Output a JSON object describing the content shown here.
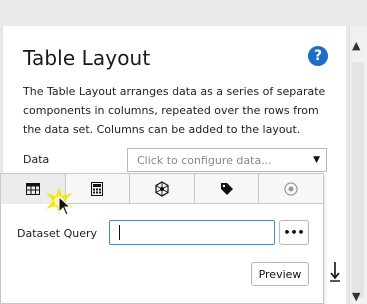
{
  "panel": {
    "title": "Table Layout",
    "help_icon": "help-icon",
    "description": "The Table Layout arranges data as a series of separate components in columns, repeated over the rows from the data set. Columns can be added to the layout.",
    "data_label": "Data",
    "data_placeholder": "Click to configure data...",
    "data_caret": "▼"
  },
  "popup": {
    "tabs": [
      {
        "icon": "table-grid-icon"
      },
      {
        "icon": "calculator-icon"
      },
      {
        "icon": "network-hexagon-icon"
      },
      {
        "icon": "tag-icon"
      },
      {
        "icon": "radio-circle-icon"
      }
    ],
    "dataset_query_label": "Dataset Query",
    "dataset_query_value": "",
    "ellipsis_label": "•••",
    "preview_label": "Preview"
  },
  "scrollbar": {
    "up": "▲",
    "down": "▼"
  },
  "colors": {
    "accent": "#3a8fd6",
    "help": "#1c6fc4",
    "highlight": "#f2e600"
  }
}
